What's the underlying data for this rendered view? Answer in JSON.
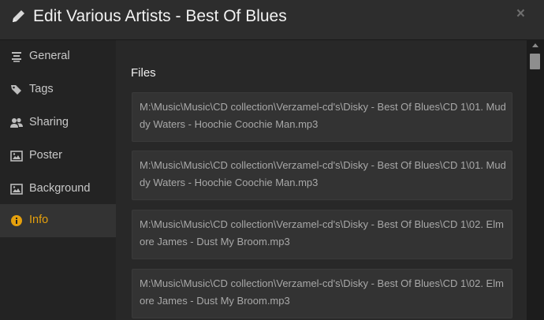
{
  "header": {
    "title": "Edit Various Artists - Best Of Blues",
    "close_label": "×"
  },
  "sidebar": {
    "items": [
      {
        "label": "General",
        "icon": "align-center-icon"
      },
      {
        "label": "Tags",
        "icon": "tags-icon"
      },
      {
        "label": "Sharing",
        "icon": "users-icon"
      },
      {
        "label": "Poster",
        "icon": "image-icon"
      },
      {
        "label": "Background",
        "icon": "image-icon"
      },
      {
        "label": "Info",
        "icon": "info-circle-icon",
        "active": true
      }
    ]
  },
  "main": {
    "section_title": "Files",
    "files": [
      "M:\\Music\\Music\\CD collection\\Verzamel-cd's\\Disky - Best Of Blues\\CD 1\\01. Muddy Waters - Hoochie Coochie Man.mp3",
      "M:\\Music\\Music\\CD collection\\Verzamel-cd's\\Disky - Best Of Blues\\CD 1\\01. Muddy Waters - Hoochie Coochie Man.mp3",
      "M:\\Music\\Music\\CD collection\\Verzamel-cd's\\Disky - Best Of Blues\\CD 1\\02. Elmore James - Dust My Broom.mp3",
      "M:\\Music\\Music\\CD collection\\Verzamel-cd's\\Disky - Best Of Blues\\CD 1\\02. Elmore James - Dust My Broom.mp3"
    ]
  },
  "colors": {
    "accent": "#e5a00d",
    "header_bg": "#2d2d2d",
    "sidebar_bg": "#232323",
    "content_bg": "#282828",
    "file_box_bg": "#333333"
  }
}
